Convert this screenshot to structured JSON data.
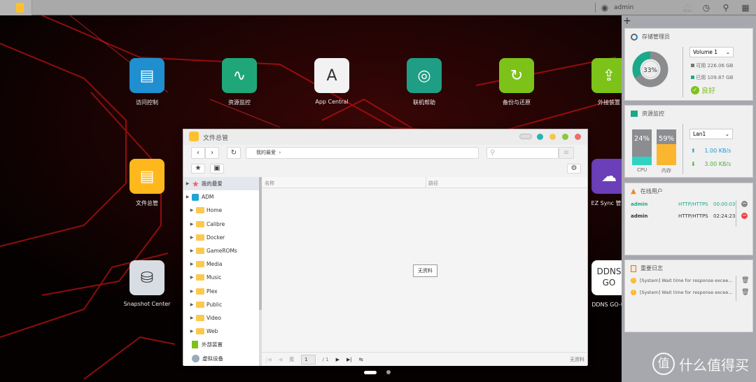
{
  "taskbar": {
    "user": "admin"
  },
  "desktop": {
    "icons": [
      {
        "label": "访问控制",
        "color": "#1f8fcf",
        "glyph": "▤"
      },
      {
        "label": "资源监控",
        "color": "#1fa77a",
        "glyph": "∿"
      },
      {
        "label": "App Central",
        "color": "#f2f2f2",
        "glyph": "A"
      },
      {
        "label": "联机帮助",
        "color": "#1f9e85",
        "glyph": "◎"
      },
      {
        "label": "备份与还原",
        "color": "#7cc219",
        "glyph": "↻"
      },
      {
        "label": "外接装置",
        "color": "#7cc219",
        "glyph": "⇪"
      },
      {
        "label": "文件总管",
        "color": "#ffb81c",
        "glyph": "▤"
      },
      {
        "label": "EZ Sync 管理",
        "color": "#6a3fb8",
        "glyph": "☁"
      },
      {
        "label": "Snapshot Center",
        "color": "#d8dce3",
        "glyph": "⛁"
      },
      {
        "label": "DDNS GO-中",
        "color": "#ffffff",
        "glyph": "DDNS GO"
      }
    ]
  },
  "window": {
    "title": "文件总管",
    "path": "我的最爱",
    "sidebar": [
      {
        "label": "我的最爱",
        "type": "fav"
      },
      {
        "label": "ADM",
        "type": "adm"
      },
      {
        "label": "Home",
        "type": "folder"
      },
      {
        "label": "Calibre",
        "type": "folder"
      },
      {
        "label": "Docker",
        "type": "folder"
      },
      {
        "label": "GameROMs",
        "type": "folder"
      },
      {
        "label": "Media",
        "type": "folder"
      },
      {
        "label": "Music",
        "type": "folder"
      },
      {
        "label": "Plex",
        "type": "folder"
      },
      {
        "label": "Public",
        "type": "folder"
      },
      {
        "label": "Video",
        "type": "folder"
      },
      {
        "label": "Web",
        "type": "folder"
      },
      {
        "label": "外部装置",
        "type": "ext"
      },
      {
        "label": "虚拟设备",
        "type": "virt"
      }
    ],
    "columns": [
      "名称",
      "路径"
    ],
    "empty": "无资料",
    "pager": {
      "page_label": "页",
      "page": "1",
      "total": "/ 1",
      "status": "无资料"
    }
  },
  "widgets": {
    "storage": {
      "title": "存储管理员",
      "percent": "33%",
      "used_fraction": 0.33,
      "volume": "Volume 1",
      "free": "可用 226.06 GB",
      "used": "已用 109.87 GB",
      "status": "良好"
    },
    "resource": {
      "title": "资源监控",
      "cpu": "24%",
      "cpu_fraction": 0.24,
      "cpu_label": "CPU",
      "mem": "59%",
      "mem_fraction": 0.59,
      "mem_label": "内存",
      "lan": "Lan1",
      "up": "1.00 KB/s",
      "down": "3.00 KB/s"
    },
    "users": {
      "title": "在线用户",
      "rows": [
        {
          "name": "admin",
          "proto": "HTTP/HTTPS",
          "time": "00:00:03",
          "current": true
        },
        {
          "name": "admin",
          "proto": "HTTP/HTTPS",
          "time": "02:24:23",
          "current": false
        }
      ]
    },
    "logs": {
      "title": "重要日志",
      "rows": [
        "[System] Wait time for response excee...",
        "[System] Wait time for response excee..."
      ]
    }
  },
  "watermark": {
    "logo": "值",
    "text": "什么值得买"
  },
  "colors": {
    "accent_green": "#1aaa8a",
    "mem": "#fbb62f",
    "cpu": "#2ed3c3",
    "up": "#1a9bd7",
    "down": "#4caf38"
  }
}
